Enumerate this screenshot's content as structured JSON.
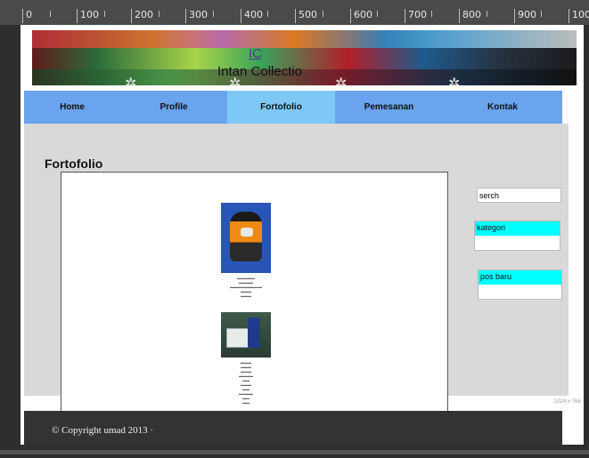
{
  "ruler": {
    "labels": [
      "0",
      "100",
      "200",
      "300",
      "400",
      "500",
      "600",
      "700",
      "800",
      "900",
      "100"
    ]
  },
  "header": {
    "logo_initials": "IC",
    "logo_name": "Intan Collectio"
  },
  "nav": {
    "items": [
      {
        "label": "Home"
      },
      {
        "label": "Profile"
      },
      {
        "label": "Fortofolio",
        "active": true
      },
      {
        "label": "Pemesanan"
      },
      {
        "label": "Kontak"
      }
    ]
  },
  "main": {
    "section_title": "Fortofolio",
    "search_value": "serch",
    "widgets": [
      {
        "title": "kategori"
      },
      {
        "title": "pos baru"
      }
    ],
    "viewport_label": "1024 x 768"
  },
  "footer": {
    "copyright": "© Copyright umad 2013 ·"
  },
  "colors": {
    "nav_bg": "#6aa3ee",
    "nav_active": "#7ec8f5",
    "widget_head": "#00ffff",
    "footer_bg": "#333333"
  }
}
